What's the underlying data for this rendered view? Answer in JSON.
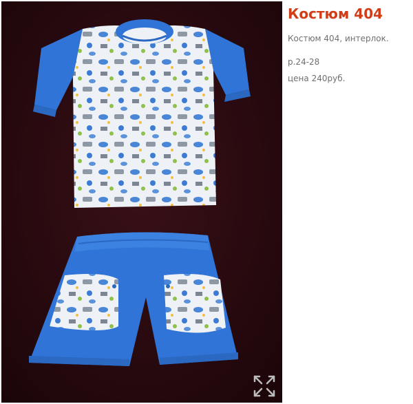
{
  "product": {
    "title": "Костюм 404",
    "description": "Костюм 404, интерлок.",
    "sizes": "р.24-28",
    "price": "цена 240руб."
  },
  "photo": {
    "icon": "expand-arrows-icon",
    "colors": {
      "background": "#2a0a10",
      "garment_blue": "#2f74d6",
      "print_white": "#eef1f5"
    }
  }
}
